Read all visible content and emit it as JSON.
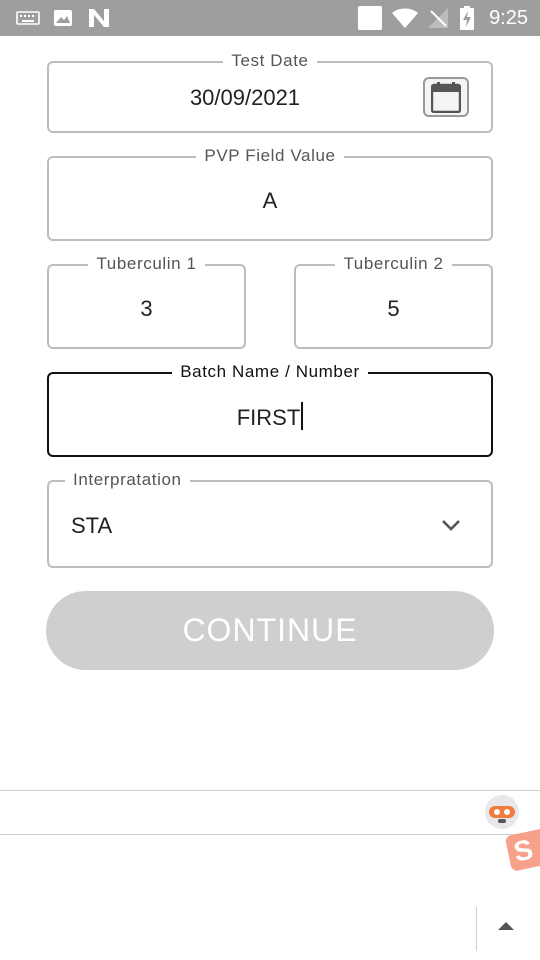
{
  "status_bar": {
    "time": "9:25",
    "icons": [
      "keyboard-icon",
      "image-icon",
      "n-logo-icon",
      "notification-square-icon",
      "wifi-icon",
      "no-signal-icon",
      "battery-charging-icon"
    ]
  },
  "form": {
    "test_date": {
      "label": "Test Date",
      "value": "30/09/2021",
      "calendar_icon": "calendar-icon"
    },
    "pvp_field": {
      "label": "PVP Field Value",
      "value": "A"
    },
    "tuberculin_1": {
      "label": "Tuberculin 1",
      "value": "3"
    },
    "tuberculin_2": {
      "label": "Tuberculin 2",
      "value": "5"
    },
    "batch": {
      "label": "Batch Name / Number",
      "value": "FIRST"
    },
    "interpretation": {
      "label": "Interpratation",
      "value": "STA",
      "icon": "chevron-down-icon"
    },
    "continue_label": "CONTINUE"
  },
  "colors": {
    "status_bar": "#9e9e9e",
    "field_border": "#bdbdbd",
    "active_border": "#111111",
    "button_disabled": "#cfcfcf"
  }
}
